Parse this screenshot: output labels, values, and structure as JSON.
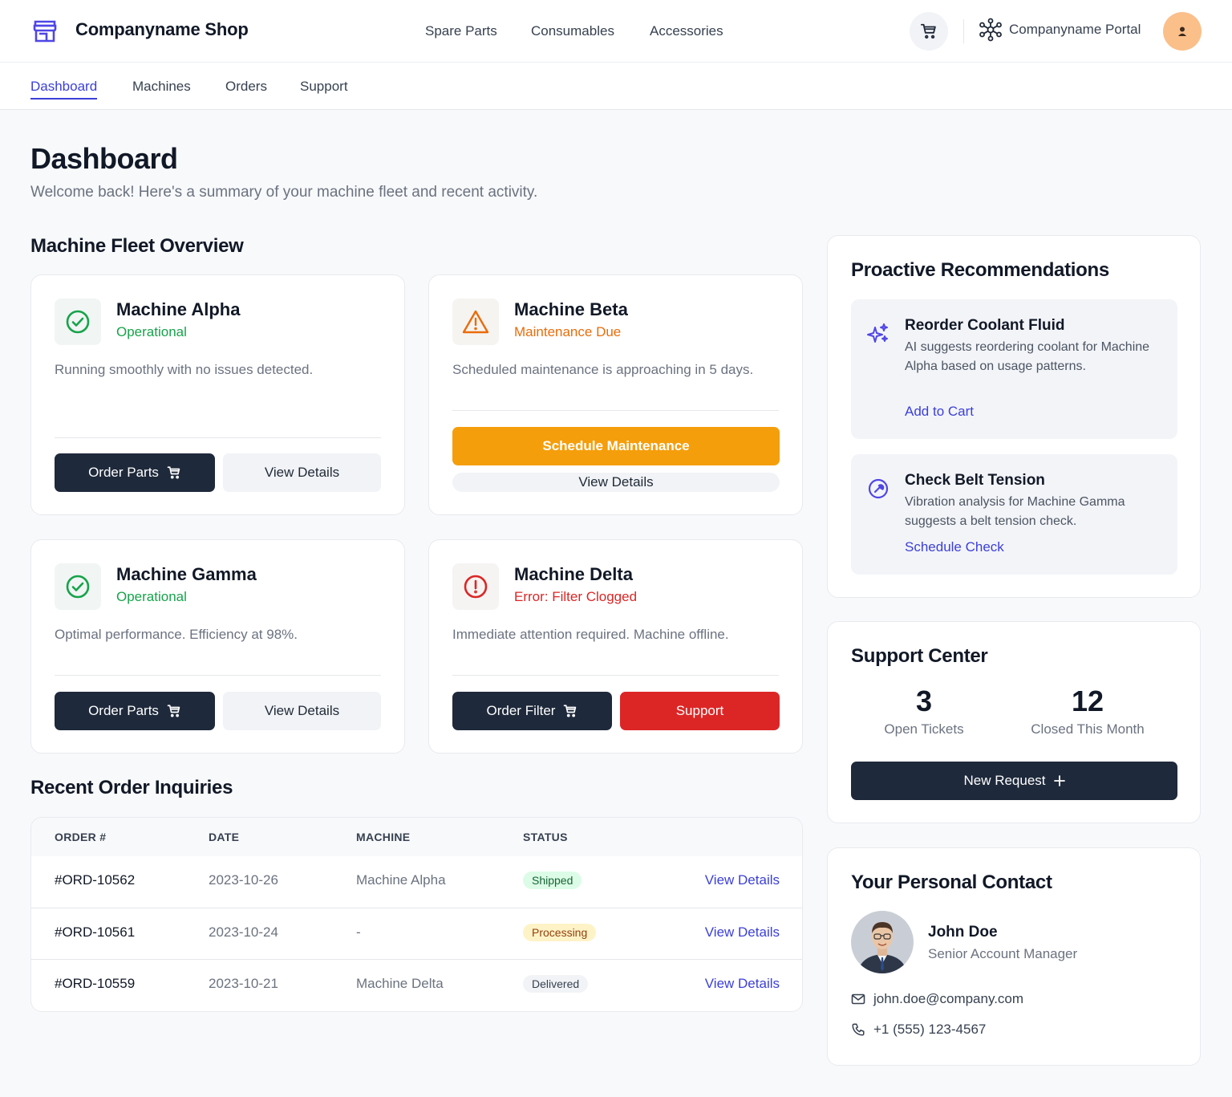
{
  "header": {
    "brand": "Companyname Shop",
    "nav": [
      "Spare Parts",
      "Consumables",
      "Accessories"
    ],
    "portal_label": "Companyname Portal"
  },
  "subnav": {
    "items": [
      "Dashboard",
      "Machines",
      "Orders",
      "Support"
    ],
    "active": "Dashboard"
  },
  "page": {
    "title": "Dashboard",
    "subtitle": "Welcome back! Here's a summary of your machine fleet and recent activity."
  },
  "fleet": {
    "title": "Machine Fleet Overview",
    "machines": [
      {
        "name": "Machine Alpha",
        "status": "Operational",
        "description": "Running smoothly with no issues detected.",
        "primary": "Order Parts",
        "secondary": "View Details"
      },
      {
        "name": "Machine Beta",
        "status": "Maintenance Due",
        "description": "Scheduled maintenance is approaching in 5 days.",
        "primary": "Schedule Maintenance",
        "secondary": "View Details"
      },
      {
        "name": "Machine Gamma",
        "status": "Operational",
        "description": "Optimal performance. Efficiency at 98%.",
        "primary": "Order Parts",
        "secondary": "View Details"
      },
      {
        "name": "Machine Delta",
        "status": "Error: Filter Clogged",
        "description": "Immediate attention required. Machine offline.",
        "primary": "Order Filter",
        "secondary": "Support"
      }
    ]
  },
  "orders": {
    "title": "Recent Order Inquiries",
    "columns": [
      "ORDER #",
      "DATE",
      "MACHINE",
      "STATUS"
    ],
    "rows": [
      {
        "order": "#ORD-10562",
        "date": "2023-10-26",
        "machine": "Machine Alpha",
        "status": "Shipped",
        "action": "View Details"
      },
      {
        "order": "#ORD-10561",
        "date": "2023-10-24",
        "machine": "-",
        "status": "Processing",
        "action": "View Details"
      },
      {
        "order": "#ORD-10559",
        "date": "2023-10-21",
        "machine": "Machine Delta",
        "status": "Delivered",
        "action": "View Details"
      }
    ]
  },
  "recommendations": {
    "title": "Proactive Recommendations",
    "items": [
      {
        "icon": "sparkles-icon",
        "title": "Reorder Coolant Fluid",
        "text": "AI suggests reordering coolant for Machine Alpha based on usage patterns.",
        "action": "Add to Cart"
      },
      {
        "icon": "wrench-icon",
        "title": "Check Belt Tension",
        "text": "Vibration analysis for Machine Gamma suggests a belt tension check.",
        "action": "Schedule Check"
      }
    ]
  },
  "support": {
    "title": "Support Center",
    "open_count": "3",
    "open_label": "Open Tickets",
    "closed_count": "12",
    "closed_label": "Closed This Month",
    "new_request": "New Request"
  },
  "contact": {
    "title": "Your Personal Contact",
    "name": "John Doe",
    "role": "Senior Account Manager",
    "email": "john.doe@company.com",
    "phone": "+1 (555) 123-4567"
  },
  "colors": {
    "accent": "#3b3fd8",
    "dark_button": "#1e293b",
    "success": "#16a34a",
    "warning": "#ea6c0a",
    "warning_button": "#f59e0b",
    "danger": "#dc2626"
  }
}
